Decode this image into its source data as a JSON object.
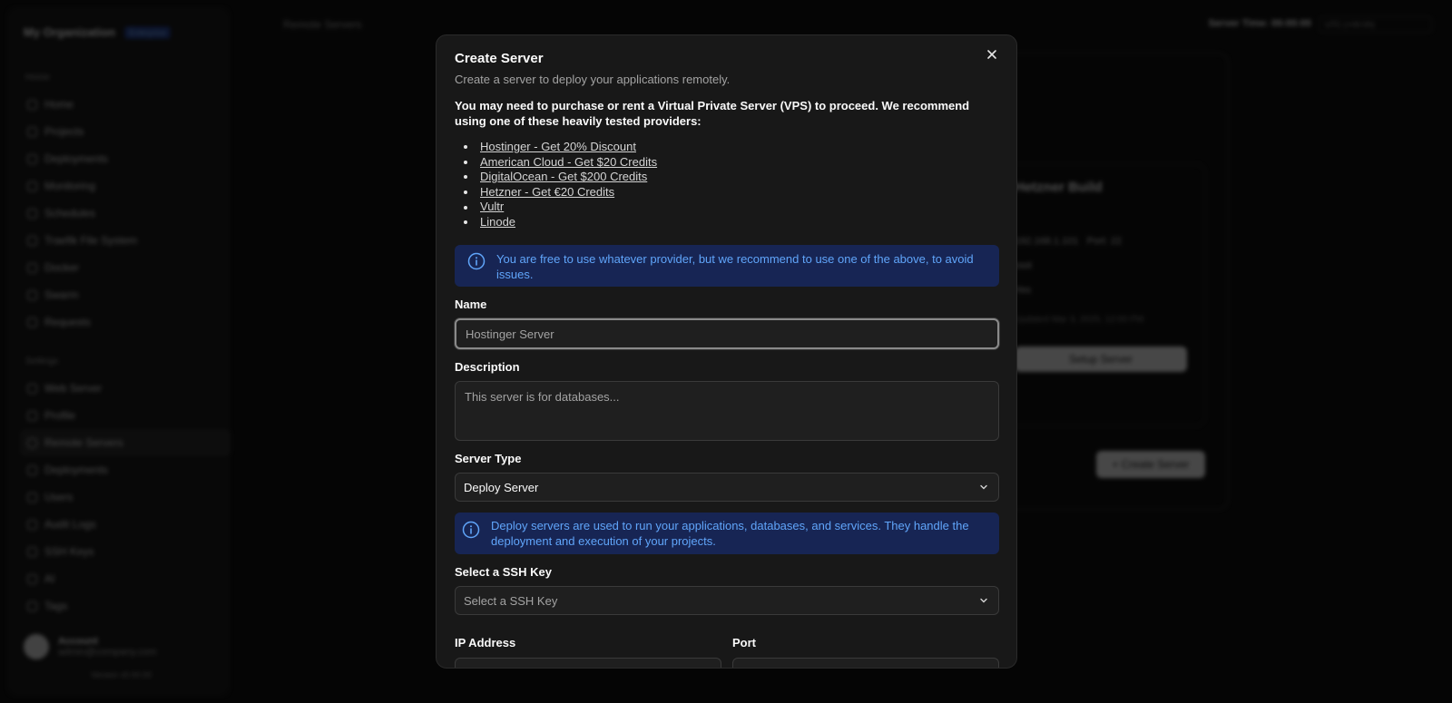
{
  "background": {
    "org_name": "My Organization",
    "org_badge": "Enterprise",
    "section_home": "Home",
    "nav_main": [
      "Home",
      "Projects",
      "Deployments",
      "Monitoring",
      "Schedules",
      "Traefik File System",
      "Docker",
      "Swarm",
      "Requests"
    ],
    "section_settings": "Settings",
    "nav_settings": [
      "Web Server",
      "Profile",
      "Remote Servers",
      "Deployments",
      "Users",
      "Audit Logs",
      "SSH Keys",
      "AI",
      "Tags"
    ],
    "active_item": "Remote Servers",
    "user_name": "Account",
    "user_email": "admin@company.com",
    "version": "Version v0.00.00",
    "page_title": "Remote Servers",
    "server_time": "Server Time: 00:00:00",
    "server_time_zone": "UTC (+00:00)",
    "card_title": "Hetzner Build",
    "card_ip": "192.168.1.101",
    "card_port_label": "Port:",
    "card_port": "22",
    "card_user": "root",
    "card_ssh": "Yes",
    "card_updated": "Updated Mar 3, 2025, 12:00 PM",
    "setup_button": "Setup Server",
    "create_button": "+ Create Server"
  },
  "modal": {
    "title": "Create Server",
    "subtitle": "Create a server to deploy your applications remotely.",
    "intro": "You may need to purchase or rent a Virtual Private Server (VPS) to proceed. We recommend using one of these heavily tested providers:",
    "providers": [
      "Hostinger - Get 20% Discount",
      "American Cloud - Get $20 Credits",
      "DigitalOcean - Get $200 Credits",
      "Hetzner - Get €20 Credits",
      "Vultr",
      "Linode"
    ],
    "provider_alert": "You are free to use whatever provider, but we recommend to use one of the above, to avoid issues.",
    "name_label": "Name",
    "name_placeholder": "Hostinger Server",
    "description_label": "Description",
    "description_placeholder": "This server is for databases...",
    "server_type_label": "Server Type",
    "server_type_value": "Deploy Server",
    "server_type_alert": "Deploy servers are used to run your applications, databases, and services. They handle the deployment and execution of your projects.",
    "ssh_key_label": "Select a SSH Key",
    "ssh_key_placeholder": "Select a SSH Key",
    "ip_label": "IP Address",
    "port_label": "Port"
  },
  "colors": {
    "alert_bg": "#172554",
    "alert_text": "#60a5fa",
    "modal_bg": "#181818"
  }
}
